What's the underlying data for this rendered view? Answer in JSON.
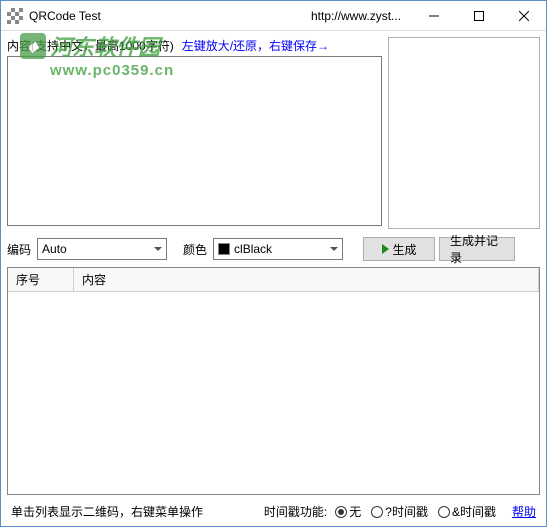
{
  "window": {
    "title": "QRCode Test",
    "url": "http://www.zyst..."
  },
  "watermark": {
    "line1": "河东软件园",
    "line2": "www.pc0359.cn"
  },
  "content": {
    "label": "内容(支持中文，最高1000字符)",
    "hint": "左键放大/还原，右键保存→",
    "value": ""
  },
  "controls": {
    "encoding_label": "编码",
    "encoding_value": "Auto",
    "color_label": "颜色",
    "color_value": "clBlack",
    "color_hex": "#000000",
    "generate_label": "生成",
    "generate_record_label": "生成并记录"
  },
  "table": {
    "col_seq": "序号",
    "col_content": "内容",
    "rows": []
  },
  "footer": {
    "list_hint": "单击列表显示二维码，右键菜单操作",
    "timestamp_label": "时间戳功能:",
    "opt_none": "无",
    "opt_q": "?时间戳",
    "opt_amp": "&时间戳",
    "selected": "none",
    "help": "帮助"
  }
}
